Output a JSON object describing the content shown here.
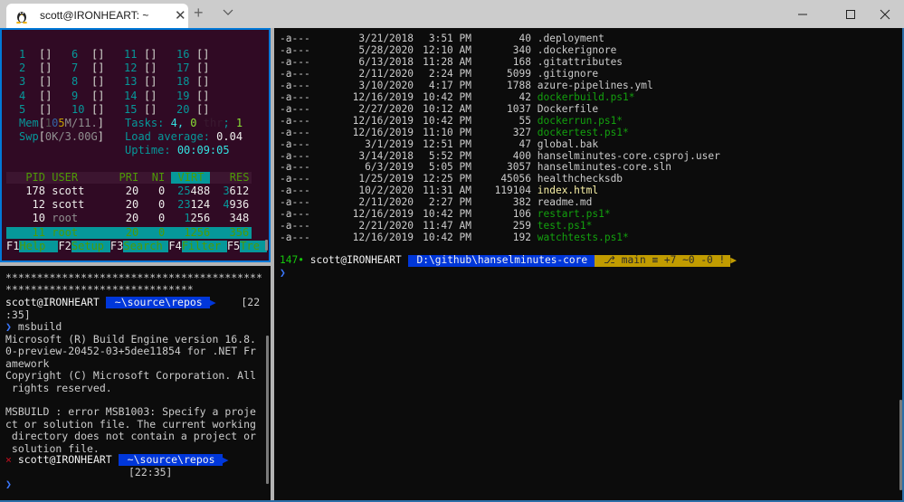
{
  "window": {
    "tab_title": "scott@IRONHEART: ~",
    "tab_icon": "linux-tux-icon",
    "new_tab": "+",
    "controls": {
      "minimize": "minimize-icon",
      "maximize": "maximize-icon",
      "close": "close-icon"
    }
  },
  "htop": {
    "cpus": [
      {
        "n": "1",
        "v": "[]"
      },
      {
        "n": "2",
        "v": "[]"
      },
      {
        "n": "3",
        "v": "[]"
      },
      {
        "n": "4",
        "v": "[]"
      },
      {
        "n": "5",
        "v": "[]"
      },
      {
        "n": "6",
        "v": "[]"
      },
      {
        "n": "7",
        "v": "[]"
      },
      {
        "n": "8",
        "v": "[]"
      },
      {
        "n": "9",
        "v": "[]"
      },
      {
        "n": "10",
        "v": "[]"
      },
      {
        "n": "11",
        "v": "[]"
      },
      {
        "n": "12",
        "v": "[]"
      },
      {
        "n": "13",
        "v": "[]"
      },
      {
        "n": "14",
        "v": "[]"
      },
      {
        "n": "15",
        "v": "[]"
      },
      {
        "n": "16",
        "v": "[]"
      },
      {
        "n": "17",
        "v": "[]"
      },
      {
        "n": "18",
        "v": "[]"
      },
      {
        "n": "19",
        "v": "[]"
      },
      {
        "n": "20",
        "v": "[]"
      }
    ],
    "mem_label": "Mem",
    "mem_value": {
      "a": "1",
      "b": "0",
      "c": "5",
      "rest": "M/11."
    },
    "swp_label": "Swp",
    "swp_value": "0K/3.00G",
    "tasks_label": "Tasks:",
    "tasks_count": "4,",
    "tasks_thr": "0",
    "tasks_thr_label": "thr",
    "tasks_running": "1",
    "load_label": "Load average:",
    "load_value": "0.04",
    "uptime_label": "Uptime:",
    "uptime_value": "00:09:05",
    "columns": {
      "pid": "PID",
      "user": "USER",
      "pri": "PRI",
      "ni": "NI",
      "virt": "VIRT",
      "res": "RES"
    },
    "processes": [
      {
        "pid": "178",
        "user": "scott",
        "pri": "20",
        "ni": "0",
        "virt_hi": "25",
        "virt_lo": "488",
        "res_hi": "3",
        "res_lo": "612"
      },
      {
        "pid": "12",
        "user": "scott",
        "pri": "20",
        "ni": "0",
        "virt_hi": "23",
        "virt_lo": "124",
        "res_hi": "4",
        "res_lo": "936"
      },
      {
        "pid": "10",
        "user": "root",
        "pri": "20",
        "ni": "0",
        "virt_hi": "1",
        "virt_lo": "256",
        "res_hi": "",
        "res_lo": "348"
      },
      {
        "pid": "11",
        "user": "root",
        "pri": "20",
        "ni": "0",
        "virt_hi": "1",
        "virt_lo": "256",
        "res_hi": "",
        "res_lo": "356"
      }
    ],
    "fkeys": [
      {
        "key": "F1",
        "label": "Help"
      },
      {
        "key": "F2",
        "label": "Setup"
      },
      {
        "key": "F3",
        "label": "Search"
      },
      {
        "key": "F4",
        "label": "Filter"
      },
      {
        "key": "F5",
        "label": "Tre"
      }
    ]
  },
  "ps_pane": {
    "stars1": "*****************************************",
    "stars2": "******************************",
    "user": "scott@IRONHEART",
    "path": "~\\source\\repos",
    "time_a": "[22",
    "time_b": ":35]",
    "command": "msbuild",
    "output": [
      "Microsoft (R) Build Engine version 16.8.",
      "0-preview-20452-03+5dee11854 for .NET Fr",
      "amework",
      "Copyright (C) Microsoft Corporation. All",
      " rights reserved.",
      "",
      "MSBUILD : error MSB1003: Specify a proje",
      "ct or solution file. The current working",
      " directory does not contain a project or",
      " solution file."
    ],
    "error_mark": "×",
    "time2": "[22:35]",
    "prompt_char": "❯"
  },
  "ls_pane": {
    "files": [
      {
        "mode": "-a---",
        "date": "3/21/2018",
        "time": "3:51 PM",
        "size": "40",
        "name": ".deployment",
        "kind": "normal"
      },
      {
        "mode": "-a---",
        "date": "5/28/2020",
        "time": "12:10 AM",
        "size": "340",
        "name": ".dockerignore",
        "kind": "normal"
      },
      {
        "mode": "-a---",
        "date": "6/13/2018",
        "time": "11:28 AM",
        "size": "168",
        "name": ".gitattributes",
        "kind": "normal"
      },
      {
        "mode": "-a---",
        "date": "2/11/2020",
        "time": "2:24 PM",
        "size": "5099",
        "name": ".gitignore",
        "kind": "normal"
      },
      {
        "mode": "-a---",
        "date": "3/10/2020",
        "time": "4:17 PM",
        "size": "1788",
        "name": "azure-pipelines.yml",
        "kind": "normal"
      },
      {
        "mode": "-a---",
        "date": "12/16/2019",
        "time": "10:42 PM",
        "size": "42",
        "name": "dockerbuild.ps1*",
        "kind": "exec"
      },
      {
        "mode": "-a---",
        "date": "2/27/2020",
        "time": "10:12 AM",
        "size": "1037",
        "name": "Dockerfile",
        "kind": "normal"
      },
      {
        "mode": "-a---",
        "date": "12/16/2019",
        "time": "10:42 PM",
        "size": "55",
        "name": "dockerrun.ps1*",
        "kind": "exec"
      },
      {
        "mode": "-a---",
        "date": "12/16/2019",
        "time": "11:10 PM",
        "size": "327",
        "name": "dockertest.ps1*",
        "kind": "exec"
      },
      {
        "mode": "-a---",
        "date": "3/1/2019",
        "time": "12:51 PM",
        "size": "47",
        "name": "global.bak",
        "kind": "normal"
      },
      {
        "mode": "-a---",
        "date": "3/14/2018",
        "time": "5:52 PM",
        "size": "400",
        "name": "hanselminutes-core.csproj.user",
        "kind": "normal"
      },
      {
        "mode": "-a---",
        "date": "6/3/2019",
        "time": "5:05 PM",
        "size": "3057",
        "name": "hanselminutes-core.sln",
        "kind": "normal"
      },
      {
        "mode": "-a---",
        "date": "1/25/2019",
        "time": "12:25 PM",
        "size": "45056",
        "name": "healthchecksdb",
        "kind": "normal"
      },
      {
        "mode": "-a---",
        "date": "10/2/2020",
        "time": "11:31 AM",
        "size": "119104",
        "name": "index.html",
        "kind": "html"
      },
      {
        "mode": "-a---",
        "date": "2/11/2020",
        "time": "2:27 PM",
        "size": "382",
        "name": "readme.md",
        "kind": "normal"
      },
      {
        "mode": "-a---",
        "date": "12/16/2019",
        "time": "10:42 PM",
        "size": "106",
        "name": "restart.ps1*",
        "kind": "exec"
      },
      {
        "mode": "-a---",
        "date": "2/21/2020",
        "time": "11:47 AM",
        "size": "259",
        "name": "test.ps1*",
        "kind": "exec"
      },
      {
        "mode": "-a---",
        "date": "12/16/2019",
        "time": "10:42 PM",
        "size": "192",
        "name": "watchtests.ps1*",
        "kind": "exec"
      }
    ],
    "history_count": "147",
    "history_mark": "•",
    "user": "scott@IRONHEART",
    "path": "D:\\github\\hanselminutes-core",
    "git_branch_icon": "⎇",
    "git_status": "main ≡ +7 ~0 -0 !",
    "prompt_char": "❯"
  },
  "colors": {
    "htop_bg": "#300a24",
    "active_border": "#0078d7",
    "path_segment": "#0037da",
    "git_segment": "#c19c00",
    "exec_file": "#13a10e",
    "html_file": "#f9f1a5"
  }
}
